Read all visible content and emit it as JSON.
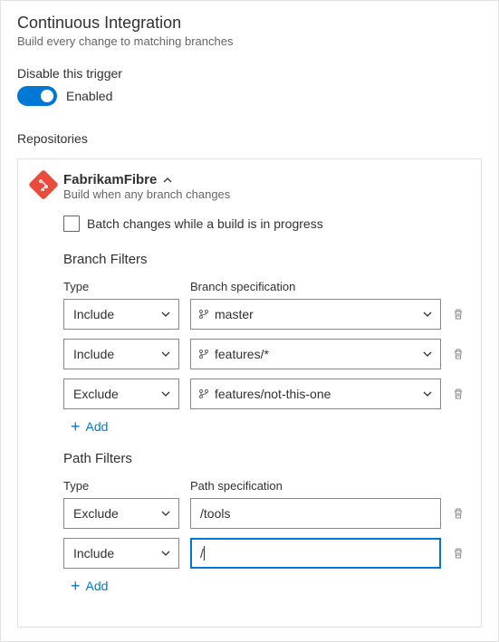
{
  "header": {
    "title": "Continuous Integration",
    "subtitle": "Build every change to matching branches"
  },
  "toggle": {
    "label": "Disable this trigger",
    "state": "Enabled"
  },
  "repositories": {
    "label": "Repositories",
    "items": [
      {
        "name": "FabrikamFibre",
        "description": "Build when any branch changes",
        "batch_label": "Batch changes while a build is in progress",
        "branch_filters": {
          "title": "Branch Filters",
          "type_header": "Type",
          "spec_header": "Branch specification",
          "rows": [
            {
              "type": "Include",
              "spec": "master"
            },
            {
              "type": "Include",
              "spec": "features/*"
            },
            {
              "type": "Exclude",
              "spec": "features/not-this-one"
            }
          ],
          "add_label": "Add"
        },
        "path_filters": {
          "title": "Path Filters",
          "type_header": "Type",
          "spec_header": "Path specification",
          "rows": [
            {
              "type": "Exclude",
              "spec": "/tools"
            },
            {
              "type": "Include",
              "spec": "/"
            }
          ],
          "add_label": "Add"
        }
      }
    ]
  }
}
